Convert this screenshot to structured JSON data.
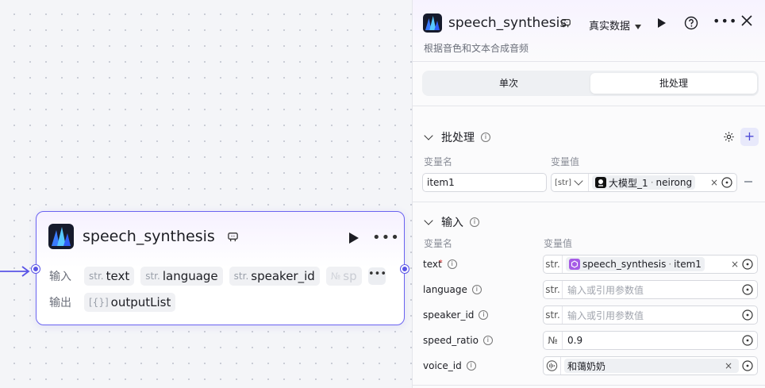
{
  "node": {
    "title": "speech_synthesis",
    "inputs_label": "输入",
    "outputs_label": "输出",
    "inputs": [
      {
        "type": "str.",
        "name": "text"
      },
      {
        "type": "str.",
        "name": "language"
      },
      {
        "type": "str.",
        "name": "speaker_id"
      },
      {
        "type": "№",
        "name": "sp"
      }
    ],
    "outputs": [
      {
        "type": "[{}]",
        "name": "outputList"
      }
    ]
  },
  "panel": {
    "title": "speech_synthesis",
    "data_source": "真实数据",
    "description": "根据音色和文本合成音频",
    "tabs": [
      "单次",
      "批处理"
    ],
    "active_tab": "批处理",
    "batch": {
      "title": "批处理",
      "var_name_header": "变量名",
      "var_value_header": "变量值",
      "item_name": "item1",
      "value_type": "[str]",
      "ref_source": "大模型_1",
      "ref_field": "neirong"
    },
    "inputs": {
      "title": "输入",
      "var_name_header": "变量名",
      "var_value_header": "变量值",
      "rows": [
        {
          "name": "text",
          "required": "*",
          "type": "str.",
          "ref_source": "speech_synthesis",
          "ref_field": "item1"
        },
        {
          "name": "language",
          "type": "str.",
          "placeholder": "输入或引用参数值"
        },
        {
          "name": "speaker_id",
          "type": "str.",
          "placeholder": "输入或引用参数值"
        },
        {
          "name": "speed_ratio",
          "type": "№",
          "value": "0.9"
        },
        {
          "name": "voice_id",
          "value": "和蔼奶奶"
        }
      ]
    }
  },
  "colors": {
    "accent": "#6a63f1",
    "port": "#5a55e6",
    "required": "#e24b4b",
    "ref_icon": "#a65ce6"
  }
}
